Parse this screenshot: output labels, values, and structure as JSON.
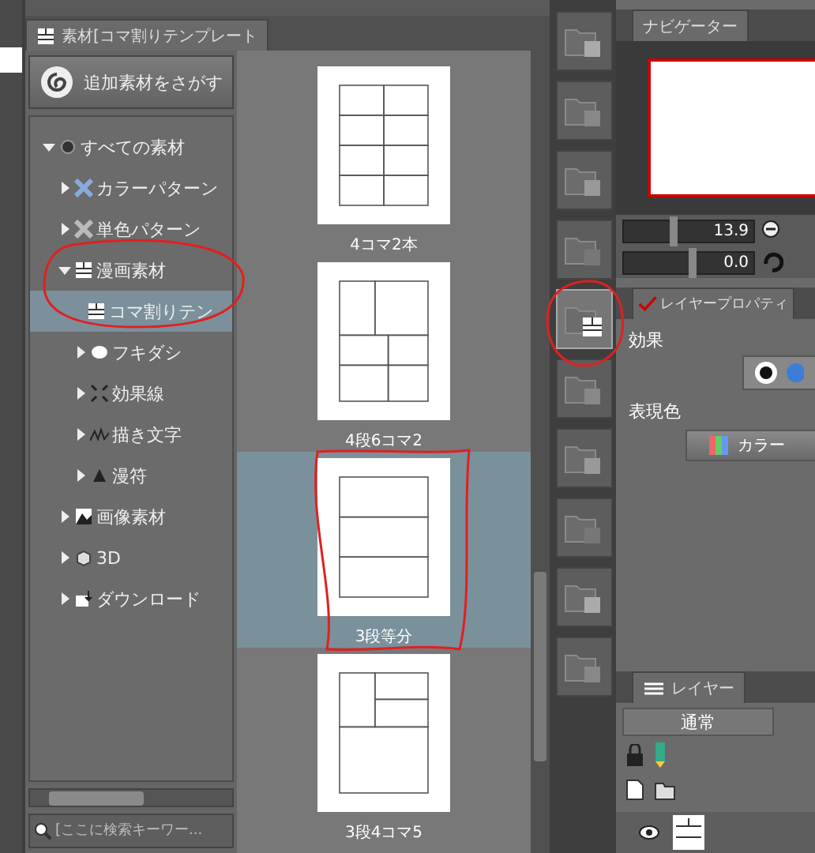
{
  "material_panel": {
    "tab_title": "素材[コマ割りテンプレート",
    "find_button": "追加素材をさがす",
    "tree": [
      {
        "label": "すべての素材",
        "expanded": true,
        "selected": false,
        "children": [
          {
            "label": "カラーパターン",
            "expanded": false,
            "selected": false
          },
          {
            "label": "単色パターン",
            "expanded": false,
            "selected": false
          },
          {
            "label": "漫画素材",
            "expanded": true,
            "selected": false,
            "children": [
              {
                "label": "コマ割りテン",
                "selected": true
              },
              {
                "label": "フキダシ",
                "expanded": false,
                "selected": false
              },
              {
                "label": "効果線",
                "expanded": false,
                "selected": false
              },
              {
                "label": "描き文字",
                "expanded": false,
                "selected": false
              },
              {
                "label": "漫符",
                "expanded": false,
                "selected": false
              }
            ]
          },
          {
            "label": "画像素材",
            "expanded": false,
            "selected": false
          },
          {
            "label": "3D",
            "expanded": false,
            "selected": false
          },
          {
            "label": "ダウンロード",
            "expanded": false,
            "selected": false
          }
        ]
      }
    ],
    "search": {
      "placeholder": "[ここに検索キーワー..."
    }
  },
  "thumbnails": [
    {
      "caption": "4コマ2本",
      "selected": false
    },
    {
      "caption": "4段6コマ2",
      "selected": false
    },
    {
      "caption": "3段等分",
      "selected": true
    },
    {
      "caption": "3段4コマ5",
      "selected": false
    }
  ],
  "folder_buttons": [
    {
      "selected": false
    },
    {
      "selected": false
    },
    {
      "selected": false
    },
    {
      "selected": false
    },
    {
      "selected": true
    },
    {
      "selected": false
    },
    {
      "selected": false
    },
    {
      "selected": false
    },
    {
      "selected": false
    },
    {
      "selected": false
    }
  ],
  "navigator": {
    "tab": "ナビゲーター",
    "zoom": {
      "reading": "13.9",
      "level": 0.35
    },
    "angle": {
      "reading": "0.0",
      "level": 0.5
    }
  },
  "layer_property": {
    "tab": "レイヤープロパティ",
    "effect_label": "効果",
    "color_label": "表現色",
    "color_button": "カラー"
  },
  "layers": {
    "tab": "レイヤー",
    "blend_mode": "通常"
  }
}
